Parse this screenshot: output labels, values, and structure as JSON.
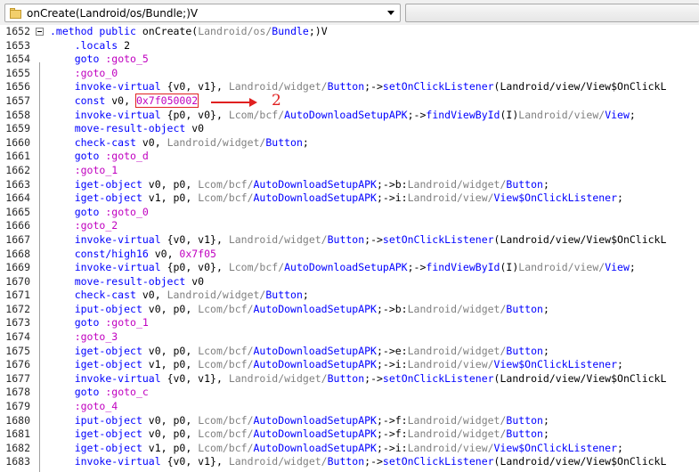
{
  "toolbar": {
    "method_combo": "onCreate(Landroid/os/Bundle;)V",
    "second_combo": ""
  },
  "annotation": "2",
  "lines": [
    {
      "n": "1652",
      "code": ".method public onCreate(Landroid/os/Bundle;)V"
    },
    {
      "n": "1653",
      "code": "    .locals 2"
    },
    {
      "n": "1654",
      "code": "    goto :goto_5"
    },
    {
      "n": "1655",
      "code": "    :goto_0"
    },
    {
      "n": "1656",
      "code": "    invoke-virtual {v0, v1}, Landroid/widget/Button;->setOnClickListener(Landroid/view/View$OnClickL"
    },
    {
      "n": "1657",
      "code": "    const v0, 0x7f050002"
    },
    {
      "n": "1658",
      "code": "    invoke-virtual {p0, v0}, Lcom/bcf/AutoDownloadSetupAPK;->findViewById(I)Landroid/view/View;"
    },
    {
      "n": "1659",
      "code": "    move-result-object v0"
    },
    {
      "n": "1660",
      "code": "    check-cast v0, Landroid/widget/Button;"
    },
    {
      "n": "1661",
      "code": "    goto :goto_d"
    },
    {
      "n": "1662",
      "code": "    :goto_1"
    },
    {
      "n": "1663",
      "code": "    iget-object v0, p0, Lcom/bcf/AutoDownloadSetupAPK;->b:Landroid/widget/Button;"
    },
    {
      "n": "1664",
      "code": "    iget-object v1, p0, Lcom/bcf/AutoDownloadSetupAPK;->i:Landroid/view/View$OnClickListener;"
    },
    {
      "n": "1665",
      "code": "    goto :goto_0"
    },
    {
      "n": "1666",
      "code": "    :goto_2"
    },
    {
      "n": "1667",
      "code": "    invoke-virtual {v0, v1}, Landroid/widget/Button;->setOnClickListener(Landroid/view/View$OnClickL"
    },
    {
      "n": "1668",
      "code": "    const/high16 v0, 0x7f05"
    },
    {
      "n": "1669",
      "code": "    invoke-virtual {p0, v0}, Lcom/bcf/AutoDownloadSetupAPK;->findViewById(I)Landroid/view/View;"
    },
    {
      "n": "1670",
      "code": "    move-result-object v0"
    },
    {
      "n": "1671",
      "code": "    check-cast v0, Landroid/widget/Button;"
    },
    {
      "n": "1672",
      "code": "    iput-object v0, p0, Lcom/bcf/AutoDownloadSetupAPK;->b:Landroid/widget/Button;"
    },
    {
      "n": "1673",
      "code": "    goto :goto_1"
    },
    {
      "n": "1674",
      "code": "    :goto_3"
    },
    {
      "n": "1675",
      "code": "    iget-object v0, p0, Lcom/bcf/AutoDownloadSetupAPK;->e:Landroid/widget/Button;"
    },
    {
      "n": "1676",
      "code": "    iget-object v1, p0, Lcom/bcf/AutoDownloadSetupAPK;->i:Landroid/view/View$OnClickListener;"
    },
    {
      "n": "1677",
      "code": "    invoke-virtual {v0, v1}, Landroid/widget/Button;->setOnClickListener(Landroid/view/View$OnClickL"
    },
    {
      "n": "1678",
      "code": "    goto :goto_c"
    },
    {
      "n": "1679",
      "code": "    :goto_4"
    },
    {
      "n": "1680",
      "code": "    iput-object v0, p0, Lcom/bcf/AutoDownloadSetupAPK;->f:Landroid/widget/Button;"
    },
    {
      "n": "1681",
      "code": "    iget-object v0, p0, Lcom/bcf/AutoDownloadSetupAPK;->f:Landroid/widget/Button;"
    },
    {
      "n": "1682",
      "code": "    iget-object v1, p0, Lcom/bcf/AutoDownloadSetupAPK;->i:Landroid/view/View$OnClickListener;"
    },
    {
      "n": "1683",
      "code": "    invoke-virtual {v0, v1}, Landroid/widget/Button;->setOnClickListener(Landroid/view/View$OnClickL"
    }
  ],
  "highlighted_token": "0x7f050002",
  "colors": {
    "keyword": "#0000ff",
    "label": "#c000c0",
    "type": "#808080",
    "annotation": "#e02020"
  }
}
